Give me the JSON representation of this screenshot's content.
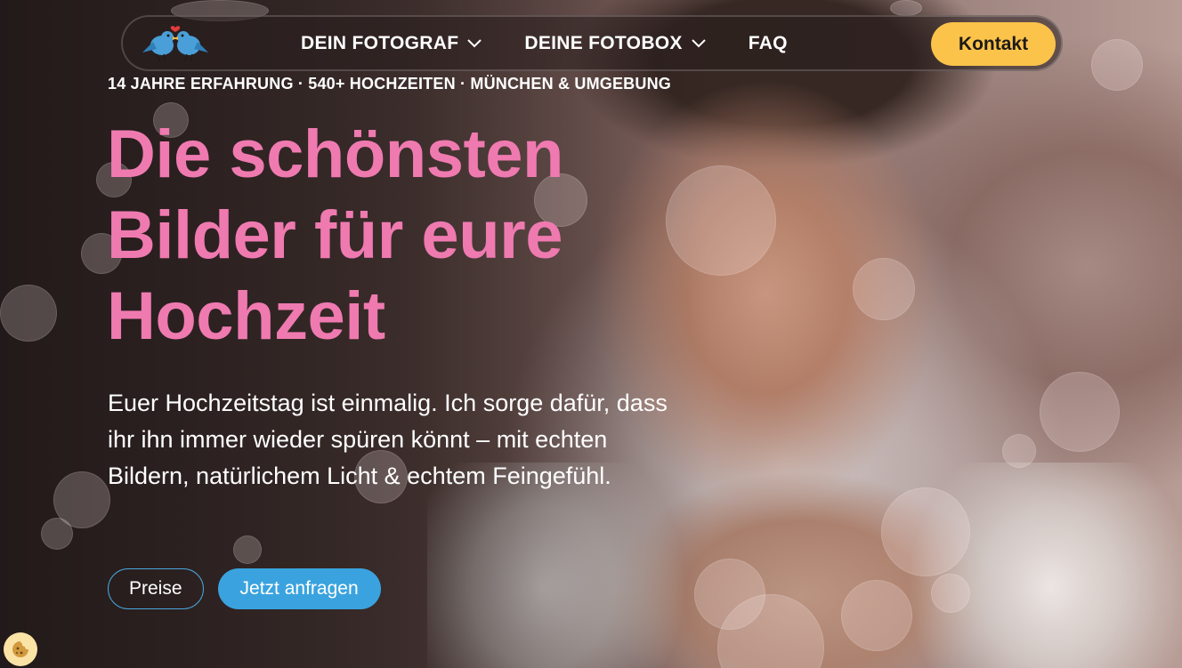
{
  "nav": {
    "logo_alt": "two-birds-logo",
    "items": [
      {
        "label": "DEIN FOTOGRAF",
        "has_dropdown": true
      },
      {
        "label": "DEINE FOTOBOX",
        "has_dropdown": true
      },
      {
        "label": "FAQ",
        "has_dropdown": false
      }
    ],
    "cta_label": "Kontakt"
  },
  "hero": {
    "tagline": "14 JAHRE ERFAHRUNG · 540+ HOCHZEITEN · MÜNCHEN & UMGEBUNG",
    "headline_lines": [
      "Die schönsten",
      "Bilder für eure",
      "Hochzeit"
    ],
    "subtext": "Euer Hochzeitstag ist einmalig. Ich sorge dafür, dass ihr ihn immer wieder spüren könnt – mit echten Bildern, natürlichem Licht & echtem Feingefühl.",
    "buttons": {
      "secondary": "Preise",
      "primary": "Jetzt anfragen"
    }
  },
  "cookie": {
    "icon": "cookie-icon"
  },
  "colors": {
    "headline": "#ef7ab0",
    "cta_yellow": "#fbc34a",
    "primary_blue": "#3aa3df"
  }
}
